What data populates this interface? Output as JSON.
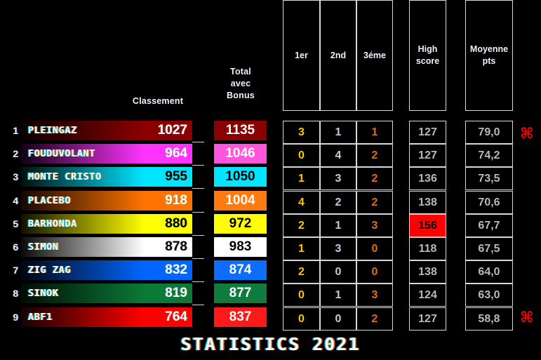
{
  "page": {
    "background": "#000000",
    "footer_title": "STATISTICS 2021",
    "accent_red": "#ff0000"
  },
  "headers": {
    "classement": "Classement",
    "total_avec_bonus": "Total\navec\nBonus",
    "total_line1": "Total",
    "total_line2": "avec",
    "total_line3": "Bonus",
    "first": "1er",
    "second": "2nd",
    "third": "3éme",
    "high_score_line1": "High",
    "high_score_line2": "score",
    "moyenne_line1": "Moyenne",
    "moyenne_line2": "pts"
  },
  "icons": {
    "command_top": "⌘",
    "command_bottom": "⌘"
  },
  "rows": [
    {
      "rank": "1",
      "name": "PLEINGAZ",
      "score": "1027",
      "total": "1135",
      "first": "3",
      "second": "1",
      "third": "1",
      "high_score": "127",
      "moyenne": "79,0",
      "bar_from": "#0a0000",
      "bar_to": "#8b0000",
      "score_color": "#ffffff",
      "total_bg": "#8b0000",
      "total_color": "#ffffff",
      "high_score_hot": false
    },
    {
      "rank": "2",
      "name": "FOUDUVOLANT",
      "score": "964",
      "total": "1046",
      "first": "0",
      "second": "4",
      "third": "2",
      "high_score": "127",
      "moyenne": "74,2",
      "bar_from": "#120014",
      "bar_to": "#ff33ff",
      "score_color": "#ffffff",
      "total_bg": "#ff55dd",
      "total_color": "#ffffff",
      "high_score_hot": false
    },
    {
      "rank": "3",
      "name": "MONTE CRISTO",
      "score": "955",
      "total": "1050",
      "first": "1",
      "second": "3",
      "third": "2",
      "high_score": "136",
      "moyenne": "73,5",
      "bar_from": "#00100f",
      "bar_to": "#00e5ff",
      "score_color": "#000000",
      "total_bg": "#00e5ff",
      "total_color": "#000000",
      "high_score_hot": false
    },
    {
      "rank": "4",
      "name": "PLACEBO",
      "score": "918",
      "total": "1004",
      "first": "4",
      "second": "2",
      "third": "2",
      "high_score": "138",
      "moyenne": "70,6",
      "bar_from": "#140700",
      "bar_to": "#ff7300",
      "score_color": "#ffffff",
      "total_bg": "#ff7a10",
      "total_color": "#ffffff",
      "high_score_hot": false
    },
    {
      "rank": "5",
      "name": "BARHONDA",
      "score": "880",
      "total": "972",
      "first": "2",
      "second": "1",
      "third": "3",
      "high_score": "156",
      "moyenne": "67,7",
      "bar_from": "#101000",
      "bar_to": "#ffff00",
      "score_color": "#000000",
      "total_bg": "#ffff00",
      "total_color": "#000000",
      "high_score_hot": true
    },
    {
      "rank": "6",
      "name": "SIMON",
      "score": "878",
      "total": "983",
      "first": "1",
      "second": "3",
      "third": "0",
      "high_score": "118",
      "moyenne": "67,5",
      "bar_from": "#0a0a0a",
      "bar_to": "#ffffff",
      "score_color": "#000000",
      "total_bg": "#ffffff",
      "total_color": "#000000",
      "high_score_hot": false
    },
    {
      "rank": "7",
      "name": "ZIG ZAG",
      "score": "832",
      "total": "874",
      "first": "2",
      "second": "0",
      "third": "0",
      "high_score": "138",
      "moyenne": "64,0",
      "bar_from": "#000510",
      "bar_to": "#0066ff",
      "score_color": "#ffffff",
      "total_bg": "#0d6efd",
      "total_color": "#ffffff",
      "high_score_hot": false
    },
    {
      "rank": "8",
      "name": "SINOK",
      "score": "819",
      "total": "877",
      "first": "0",
      "second": "1",
      "third": "3",
      "high_score": "124",
      "moyenne": "63,0",
      "bar_from": "#000c05",
      "bar_to": "#0a7a36",
      "score_color": "#ffffff",
      "total_bg": "#0f7b3c",
      "total_color": "#ffffff",
      "high_score_hot": false
    },
    {
      "rank": "9",
      "name": "ABF1",
      "score": "764",
      "total": "837",
      "first": "0",
      "second": "0",
      "third": "2",
      "high_score": "127",
      "moyenne": "58,8",
      "bar_from": "#140000",
      "bar_to": "#ff0000",
      "score_color": "#ffffff",
      "total_bg": "#ff1a1a",
      "total_color": "#ffffff",
      "high_score_hot": false
    }
  ]
}
